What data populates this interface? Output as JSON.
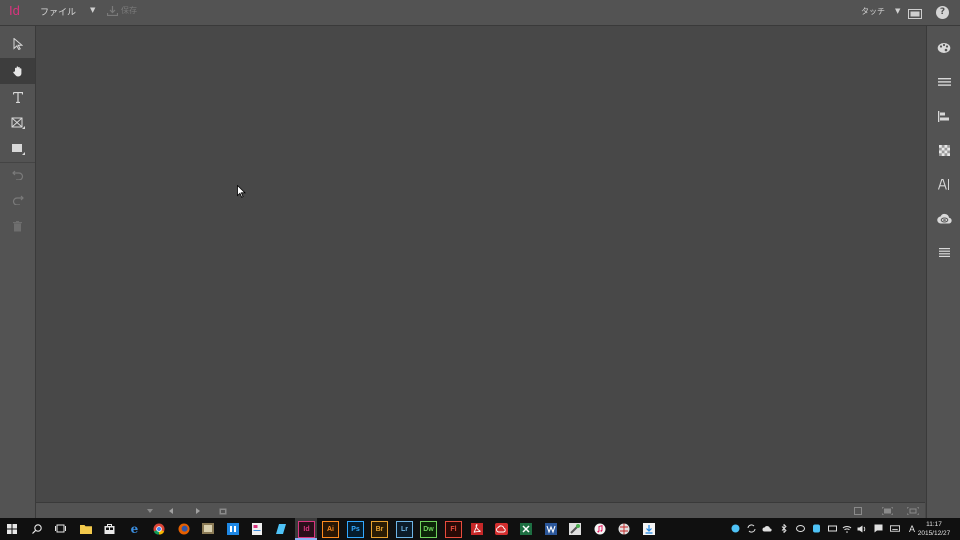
{
  "app": {
    "logo": "Id",
    "brand_color": "#d8347e"
  },
  "topbar": {
    "file_menu": "ファイル",
    "save_label": "保存",
    "touch_mode": "タッチ",
    "help": "?"
  },
  "left_tools": [
    "selection-arrow-icon",
    "hand-tool-icon",
    "type-tool-icon",
    "frame-tool-icon",
    "rectangle-tool-icon",
    "undo-icon",
    "redo-icon",
    "trash-icon"
  ],
  "right_panels": [
    "color-palette-icon",
    "stroke-icon",
    "align-icon",
    "swatches-icon",
    "character-icon",
    "creative-cloud-libraries-icon",
    "paragraph-icon"
  ],
  "taskbar": {
    "apps": [
      {
        "label": "Id",
        "color": "#d8347e"
      },
      {
        "label": "Ai",
        "color": "#ff8a1e"
      },
      {
        "label": "Ps",
        "color": "#31a8ff"
      },
      {
        "label": "Br",
        "color": "#e8a230"
      },
      {
        "label": "Lr",
        "color": "#6fb5e6"
      },
      {
        "label": "Dw",
        "color": "#6fd15c"
      },
      {
        "label": "Fl",
        "color": "#e84c3d"
      }
    ],
    "ime": "A",
    "time": "11:17",
    "date": "2015/12/27"
  }
}
